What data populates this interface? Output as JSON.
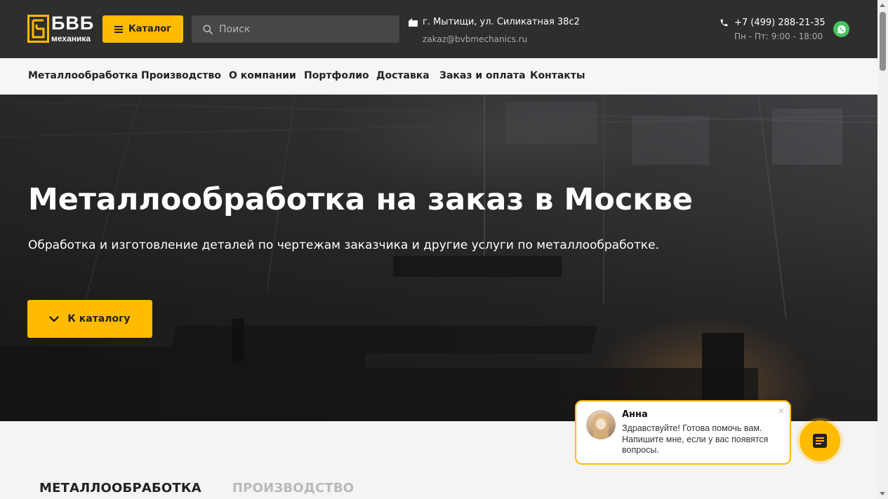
{
  "header": {
    "logo": {
      "text": "БВБ",
      "subtext": "механика"
    },
    "catalog_label": "Каталог",
    "search": {
      "placeholder": "Поиск"
    },
    "address": "г. Мытищи, ул. Силикатная 38с2",
    "email": "zakaz@bvbmechanics.ru",
    "phone": "+7 (499) 288-21-35",
    "hours": "Пн - Пт: 9:00 - 18:00",
    "icons": {
      "location": "building-icon",
      "phone": "phone-icon",
      "messenger": "whatsapp-icon",
      "search": "search-icon",
      "catalog": "menu-icon"
    }
  },
  "nav": {
    "items": [
      {
        "label": "Металлообработка"
      },
      {
        "label": "Производство"
      },
      {
        "label": "О компании"
      },
      {
        "label": "Портфолио"
      },
      {
        "label": "Доставка"
      },
      {
        "label": "Заказ и оплата"
      },
      {
        "label": "Контакты"
      }
    ]
  },
  "hero": {
    "title": "Металлообработка на заказ в Москве",
    "subtitle": "Обработка и изготовление деталей по чертежам заказчика и другие услуги по металлообработке.",
    "button_label": "К каталогу"
  },
  "tabs": {
    "items": [
      {
        "label": "МЕТАЛЛООБРАБОТКА",
        "active": true
      },
      {
        "label": "ПРОИЗВОДСТВО",
        "active": false
      }
    ]
  },
  "chat": {
    "name": "Анна",
    "message": "Здравствуйте! Готова помочь вам. Напишите мне, если у вас появятся вопросы.",
    "close": "×"
  },
  "colors": {
    "accent": "#ffbb00",
    "header_bg": "#2e2e2e",
    "whatsapp": "#43c55f"
  }
}
